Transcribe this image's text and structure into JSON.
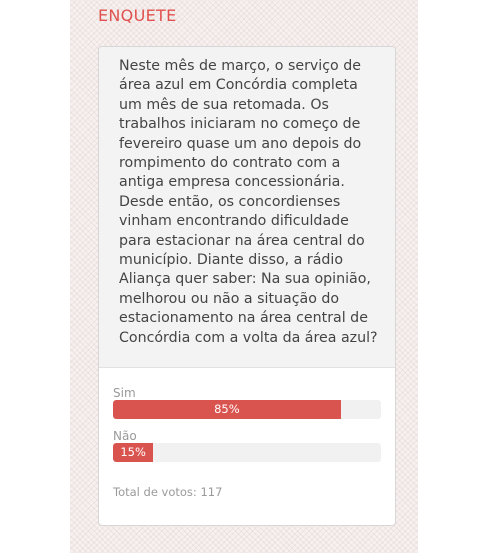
{
  "poll": {
    "section_title": "ENQUETE",
    "question": "Neste mês de março, o serviço de área azul em Concórdia completa um mês de sua retomada. Os trabalhos iniciaram no começo de fevereiro quase um ano depois do rompimento do contrato com a antiga empresa concessionária. Desde então, os concordienses vinham encontrando dificuldade para estacionar na área central do município. Diante disso, a rádio Aliança quer saber: Na sua opinião, melhorou ou não a situação do estacionamento na área central de Concórdia com a volta da área azul?",
    "options": [
      {
        "label": "Sim",
        "percent": 85,
        "percent_label": "85%"
      },
      {
        "label": "Não",
        "percent": 15,
        "percent_label": "15%"
      }
    ],
    "total_label": "Total de votos: 117"
  },
  "colors": {
    "accent": "#e0524e",
    "bar_fill": "#d9534f",
    "bar_track": "#f1f1f1",
    "muted_text": "#9a9a9a",
    "question_text": "#444444"
  }
}
